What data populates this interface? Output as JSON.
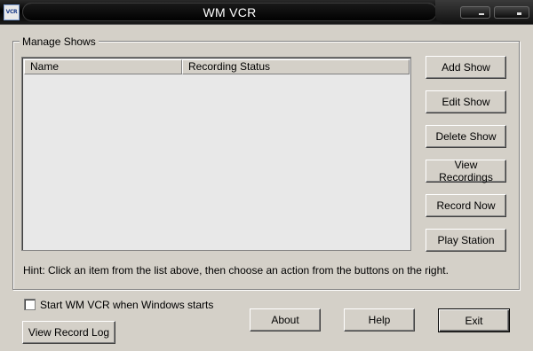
{
  "window": {
    "title": "WM VCR",
    "icon_text": "VCR",
    "icon_name": "vcr-app-icon"
  },
  "group": {
    "label": "Manage Shows"
  },
  "list": {
    "columns": [
      "Name",
      "Recording Status"
    ],
    "rows": []
  },
  "actions": {
    "add_show": "Add Show",
    "edit_show": "Edit Show",
    "delete_show": "Delete Show",
    "view_recordings": "View Recordings",
    "record_now": "Record Now",
    "play_station": "Play Station"
  },
  "hint": "Hint: Click an item from the list above, then choose an action from the buttons on the right.",
  "startup": {
    "label": "Start WM VCR when Windows starts",
    "checked": false
  },
  "footer": {
    "view_record_log": "View Record Log",
    "about": "About",
    "help": "Help",
    "exit": "Exit"
  }
}
